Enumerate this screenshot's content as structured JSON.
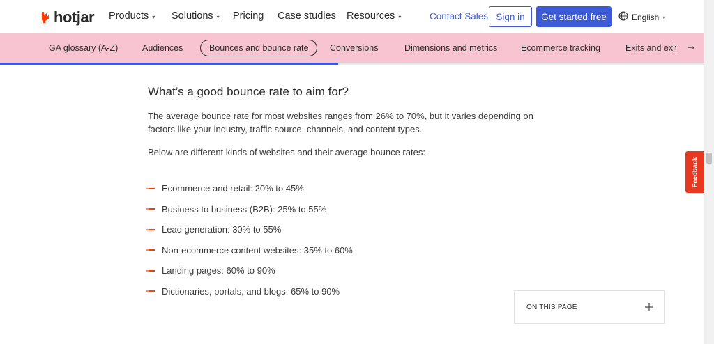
{
  "header": {
    "brand": "hotjar",
    "nav": [
      {
        "label": "Products",
        "has_menu": true
      },
      {
        "label": "Solutions",
        "has_menu": true
      },
      {
        "label": "Pricing",
        "has_menu": false
      },
      {
        "label": "Case studies",
        "has_menu": false
      },
      {
        "label": "Resources",
        "has_menu": true
      }
    ],
    "contact_sales": "Contact Sales",
    "sign_in": "Sign in",
    "get_started": "Get started free",
    "language": "English"
  },
  "tabs": {
    "items": [
      {
        "label": "GA glossary (A-Z)"
      },
      {
        "label": "Audiences"
      },
      {
        "label": "Bounces and bounce rate",
        "active": true
      },
      {
        "label": "Conversions"
      },
      {
        "label": "Dimensions and metrics"
      },
      {
        "label": "Ecommerce tracking"
      },
      {
        "label": "Exits and exit r"
      }
    ],
    "progress_fraction": 0.48
  },
  "article": {
    "heading": "What’s a good bounce rate to aim for?",
    "para1": "The average bounce rate for most websites ranges from 26% to 70%, but it varies depending on factors like your industry, traffic source, channels, and content types.",
    "para2": "Below are different kinds of websites and their average bounce rates:",
    "list": [
      "Ecommerce and retail: 20% to 45%",
      "Business to business (B2B): 25% to 55%",
      "Lead generation: 30% to 55%",
      "Non-ecommerce content websites: 35% to 60%",
      "Landing pages: 60% to 90%",
      "Dictionaries, portals, and blogs: 65% to 90%"
    ]
  },
  "on_this_page": {
    "label": "ON THIS PAGE",
    "icon": "plus-icon"
  },
  "feedback": {
    "label": "Feedback"
  },
  "colors": {
    "accent": "#3c5ad6",
    "tabs_bg": "#f9c4d2",
    "brand_orange": "#ff3c00",
    "feedback_bg": "#e8381f"
  }
}
